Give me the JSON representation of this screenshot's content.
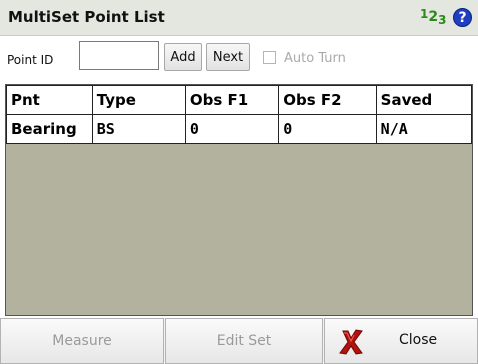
{
  "header": {
    "title": "MultiSet Point List",
    "num_icon": {
      "d1": "1",
      "d2": "2",
      "d3": "3"
    },
    "help_icon": "?"
  },
  "toolbar": {
    "point_id_label": "Point ID",
    "point_id_value": "",
    "add_label": "Add",
    "next_label": "Next",
    "auto_turn_label": "Auto Turn",
    "auto_turn_checked": false,
    "auto_turn_enabled": false
  },
  "table": {
    "columns": [
      "Pnt",
      "Type",
      "Obs F1",
      "Obs F2",
      "Saved"
    ],
    "rows": [
      [
        "Bearing",
        "BS",
        "0",
        "0",
        "N/A"
      ]
    ]
  },
  "footer": {
    "measure_label": "Measure",
    "measure_enabled": false,
    "edit_set_label": "Edit Set",
    "edit_set_enabled": false,
    "close_label": "Close"
  },
  "colors": {
    "table_empty_bg": "#b2b29f",
    "title_bar_bg": "#e4e6e0",
    "help_icon": "#1f3fc0",
    "num_icon": "#2b8a1a",
    "close_x": "#b3120e"
  }
}
